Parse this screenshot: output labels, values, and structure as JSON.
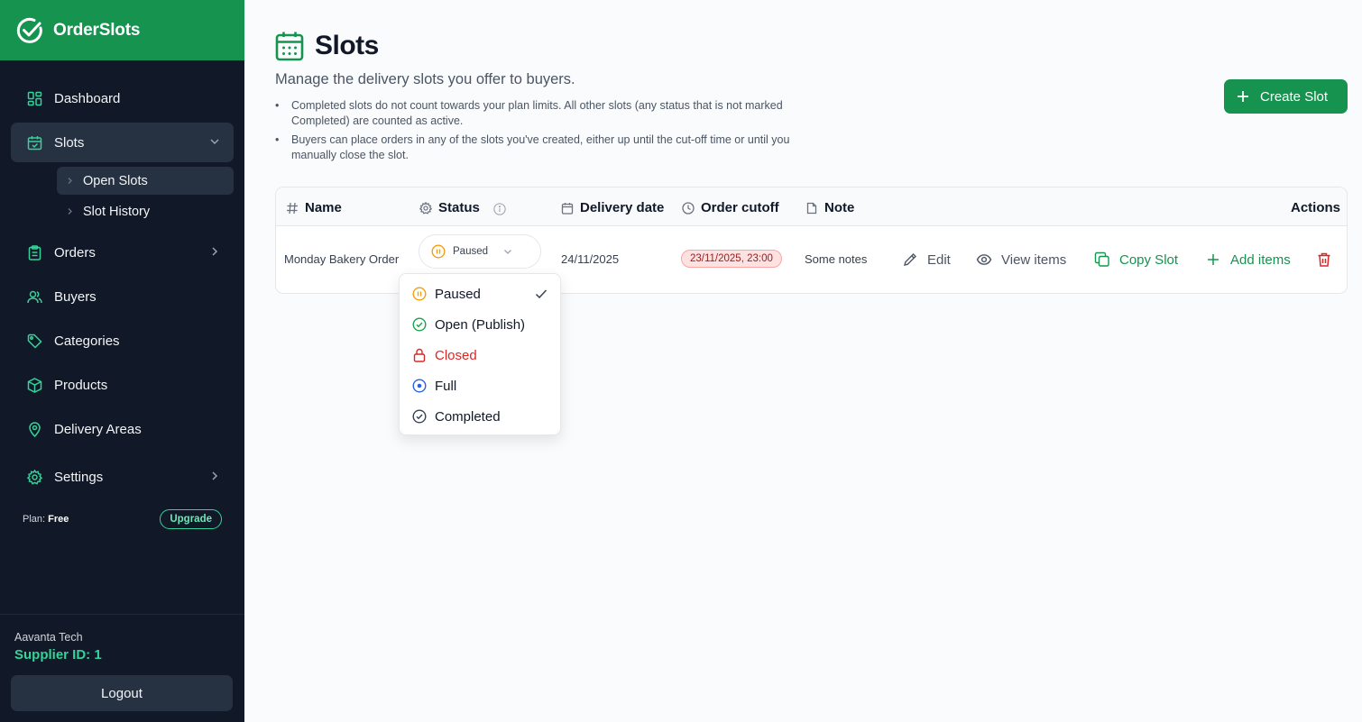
{
  "app": {
    "name": "OrderSlots"
  },
  "sidebar": {
    "items": [
      {
        "label": "Dashboard",
        "icon": "dashboard-icon"
      },
      {
        "label": "Slots",
        "icon": "calendar-icon"
      },
      {
        "label": "Orders",
        "icon": "clipboard-icon"
      },
      {
        "label": "Buyers",
        "icon": "users-icon"
      },
      {
        "label": "Categories",
        "icon": "tag-icon"
      },
      {
        "label": "Products",
        "icon": "box-icon"
      },
      {
        "label": "Delivery Areas",
        "icon": "map-pin-icon"
      },
      {
        "label": "Settings",
        "icon": "gear-icon"
      }
    ],
    "slots_sub": [
      {
        "label": "Open Slots"
      },
      {
        "label": "Slot History"
      }
    ],
    "plan_label": "Plan:",
    "plan_value": "Free",
    "upgrade_label": "Upgrade",
    "company": "Aavanta Tech",
    "supplier": "Supplier ID: 1",
    "logout_label": "Logout"
  },
  "page": {
    "title": "Slots",
    "subtitle": "Manage the delivery slots you offer to buyers.",
    "bullets": [
      "Completed slots do not count towards your plan limits. All other slots (any status that is not marked Completed) are counted as active.",
      "Buyers can place orders in any of the slots you've created, either up until the cut-off time or until you manually close the slot."
    ],
    "create_label": "Create Slot"
  },
  "table": {
    "headers": {
      "name": "Name",
      "status": "Status",
      "delivery": "Delivery date",
      "cutoff": "Order cutoff",
      "note": "Note",
      "actions": "Actions"
    },
    "rows": [
      {
        "name": "Monday Bakery Order",
        "status": "Paused",
        "delivery": "24/11/2025",
        "cutoff": "23/11/2025, 23:00",
        "note": "Some notes"
      }
    ],
    "actions": {
      "edit": "Edit",
      "view": "View items",
      "copy": "Copy Slot",
      "add": "Add items"
    }
  },
  "status_menu": {
    "options": [
      {
        "label": "Paused",
        "icon": "pause-circle-icon",
        "color": "#f59e0b"
      },
      {
        "label": "Open (Publish)",
        "icon": "check-circle-icon",
        "color": "#16a34a"
      },
      {
        "label": "Closed",
        "icon": "lock-icon",
        "color": "#dc2626"
      },
      {
        "label": "Full",
        "icon": "dot-circle-icon",
        "color": "#2563eb"
      },
      {
        "label": "Completed",
        "icon": "check-circle-icon",
        "color": "#374151"
      }
    ],
    "selected": "Paused"
  },
  "colors": {
    "brand": "#15934f",
    "sidebar_bg": "#111827",
    "accent_light": "#34d399"
  }
}
